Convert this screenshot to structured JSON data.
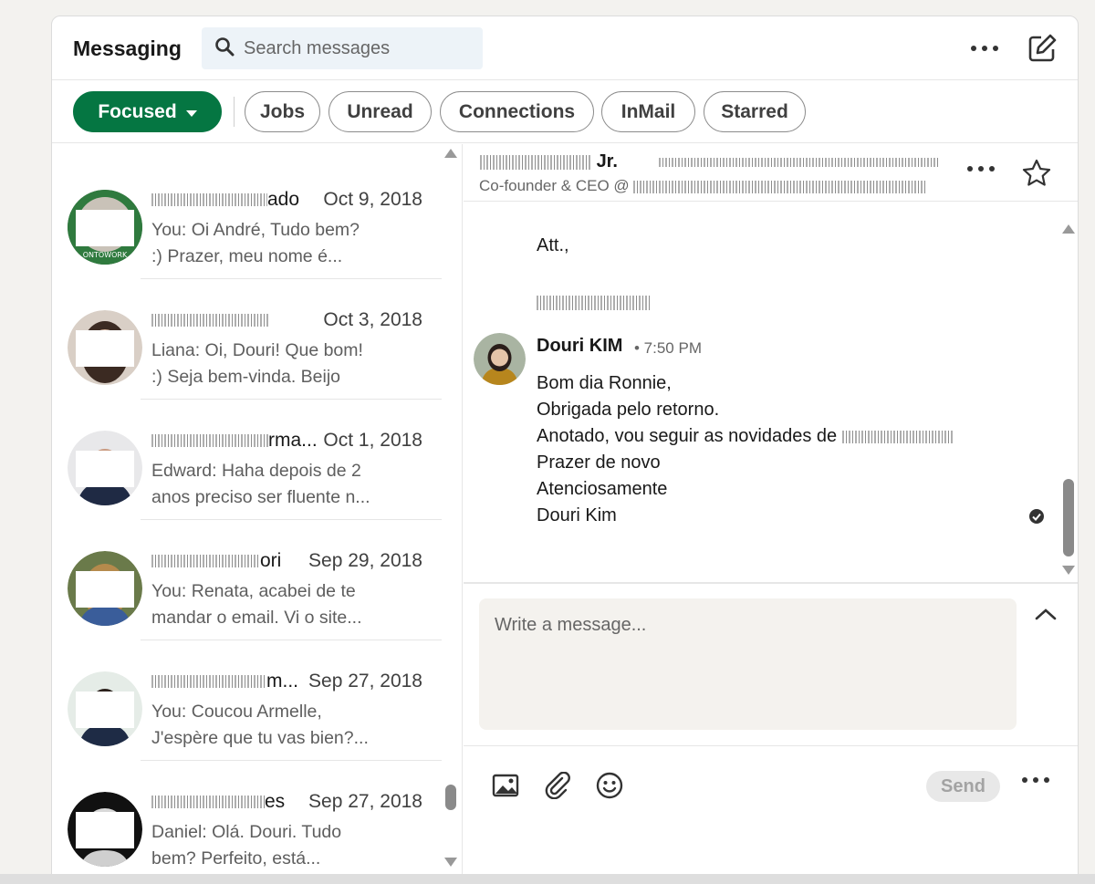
{
  "header": {
    "title": "Messaging",
    "search_placeholder": "Search messages"
  },
  "filters": [
    {
      "label": "Focused",
      "active": true
    },
    {
      "label": "Jobs"
    },
    {
      "label": "Unread"
    },
    {
      "label": "Connections"
    },
    {
      "label": "InMail"
    },
    {
      "label": "Starred"
    }
  ],
  "conversations": [
    {
      "name_suffix": "ado",
      "date": "Oct 9, 2018",
      "snippet1": "You: Oi André, Tudo bem?",
      "snippet2": ":) Prazer, meu nome é..."
    },
    {
      "name_suffix": "",
      "date": "Oct 3, 2018",
      "snippet1": "Liana: Oi, Douri! Que bom!",
      "snippet2": ":) Seja bem-vinda. Beijo"
    },
    {
      "name_suffix": "rma...",
      "date": "Oct 1, 2018",
      "snippet1": "Edward: Haha depois de 2",
      "snippet2": "anos preciso ser fluente n..."
    },
    {
      "name_suffix": "ori",
      "date": "Sep 29, 2018",
      "snippet1": "You: Renata, acabei de te",
      "snippet2": "mandar o email. Vi o site..."
    },
    {
      "name_suffix": "m...",
      "date": "Sep 27, 2018",
      "snippet1": "You: Coucou Armelle,",
      "snippet2": "J'espère que tu vas bien?..."
    },
    {
      "name_suffix": "es",
      "date": "Sep 27, 2018",
      "snippet1": "Daniel: Olá. Douri. Tudo",
      "snippet2": "bem? Perfeito, está..."
    }
  ],
  "thread": {
    "contact_suffix": "Jr.",
    "contact_title_prefix": "Co-founder & CEO @",
    "closing": "Att.,",
    "sender": "Douri KIM",
    "time": "• 7:50 PM",
    "body": {
      "l1": "Bom dia Ronnie,",
      "l2": "Obrigada pelo retorno.",
      "l3": "Anotado, vou seguir as novidades de",
      "l4": "Prazer de novo",
      "l5": "Atenciosamente",
      "l6": "Douri Kim"
    }
  },
  "composer": {
    "placeholder": "Write a message...",
    "send_label": "Send"
  },
  "colors": {
    "accent": "#057642",
    "bg": "#f3f2ef"
  }
}
